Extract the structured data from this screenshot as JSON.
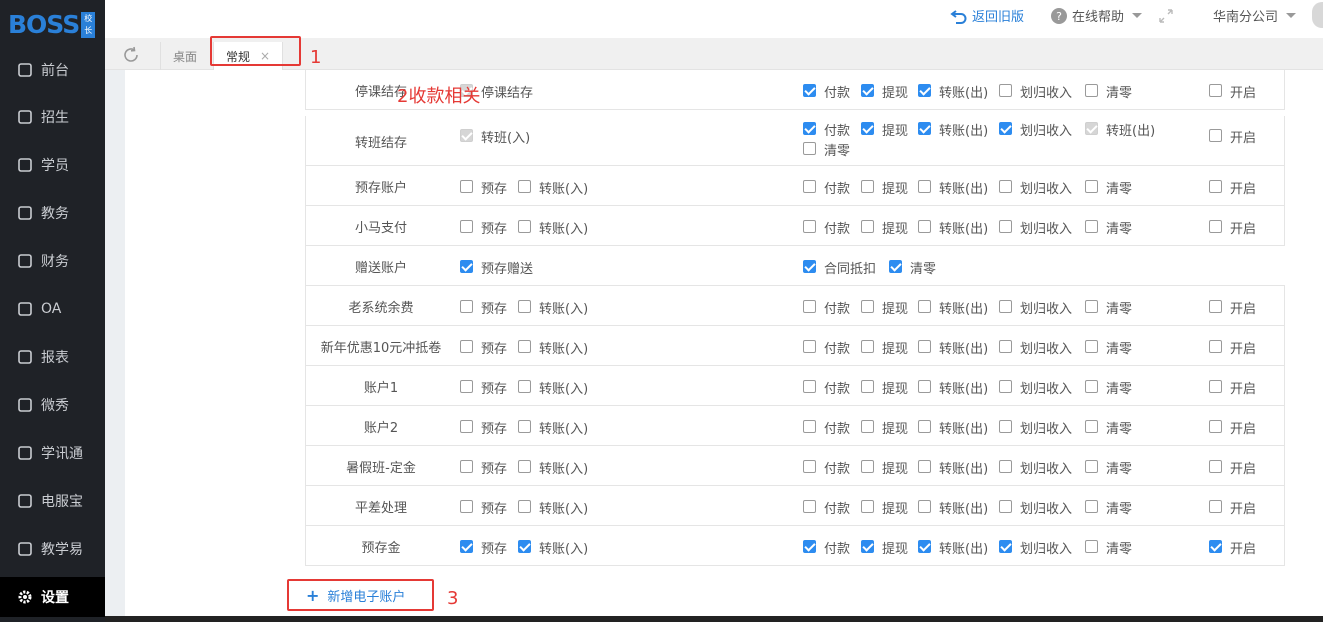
{
  "app": {
    "logo": "BOSS",
    "logo_badge": "校长"
  },
  "sidebar": {
    "items": [
      {
        "label": "前台",
        "icon": "front-desk-icon"
      },
      {
        "label": "招生",
        "icon": "enroll-icon"
      },
      {
        "label": "学员",
        "icon": "student-icon"
      },
      {
        "label": "教务",
        "icon": "academic-icon"
      },
      {
        "label": "财务",
        "icon": "finance-icon"
      },
      {
        "label": "OA",
        "icon": "oa-icon"
      },
      {
        "label": "报表",
        "icon": "report-icon"
      },
      {
        "label": "微秀",
        "icon": "weixiu-icon"
      },
      {
        "label": "学讯通",
        "icon": "location-icon"
      },
      {
        "label": "电服宝",
        "icon": "phone-service-icon"
      },
      {
        "label": "教学易",
        "icon": "teaching-icon"
      },
      {
        "label": "设置",
        "icon": "gear-icon"
      }
    ]
  },
  "topbar": {
    "back_label": "返回旧版",
    "help_label": "在线帮助",
    "company_label": "华南分公司"
  },
  "tabs": {
    "desk_label": "桌面",
    "normal_label": "常规",
    "close_glyph": "×"
  },
  "annotations": {
    "m1": "1",
    "m2": "2收款相关",
    "m3": "3"
  },
  "add_button": {
    "label": "新增电子账户",
    "plus": "+"
  },
  "table": {
    "rows": [
      {
        "name": "停课结存",
        "left": [
          {
            "checked": true,
            "disabled": true,
            "label": "停课结存"
          }
        ],
        "right": [
          {
            "checked": true,
            "label": "付款"
          },
          {
            "checked": true,
            "label": "提现"
          },
          {
            "checked": true,
            "label": "转账(出)"
          },
          {
            "checked": false,
            "label": "划归收入"
          },
          {
            "checked": false,
            "label": "清零"
          }
        ],
        "open": {
          "checked": false,
          "label": "开启"
        }
      },
      {
        "name": "转班结存",
        "left": [
          {
            "checked": true,
            "disabled": true,
            "label": "转班(入)"
          }
        ],
        "right": [
          {
            "checked": true,
            "label": "付款"
          },
          {
            "checked": true,
            "label": "提现"
          },
          {
            "checked": true,
            "label": "转账(出)"
          },
          {
            "checked": true,
            "label": "划归收入"
          },
          {
            "checked": true,
            "disabled": true,
            "label": "转班(出)"
          },
          {
            "checked": false,
            "label": "清零"
          }
        ],
        "open": {
          "checked": false,
          "label": "开启"
        }
      },
      {
        "name": "预存账户",
        "left": [
          {
            "checked": false,
            "label": "预存"
          },
          {
            "checked": false,
            "label": "转账(入)"
          }
        ],
        "right": [
          {
            "checked": false,
            "label": "付款"
          },
          {
            "checked": false,
            "label": "提现"
          },
          {
            "checked": false,
            "label": "转账(出)"
          },
          {
            "checked": false,
            "label": "划归收入"
          },
          {
            "checked": false,
            "label": "清零"
          }
        ],
        "open": {
          "checked": false,
          "label": "开启"
        }
      },
      {
        "name": "小马支付",
        "left": [
          {
            "checked": false,
            "label": "预存"
          },
          {
            "checked": false,
            "label": "转账(入)"
          }
        ],
        "right": [
          {
            "checked": false,
            "label": "付款"
          },
          {
            "checked": false,
            "label": "提现"
          },
          {
            "checked": false,
            "label": "转账(出)"
          },
          {
            "checked": false,
            "label": "划归收入"
          },
          {
            "checked": false,
            "label": "清零"
          }
        ],
        "open": {
          "checked": false,
          "label": "开启"
        }
      },
      {
        "name": "赠送账户",
        "left": [
          {
            "checked": true,
            "label": "预存赠送"
          }
        ],
        "right": [
          {
            "checked": true,
            "label": "合同抵扣"
          },
          {
            "checked": true,
            "label": "清零"
          }
        ],
        "open": null
      },
      {
        "name": "老系统余费",
        "left": [
          {
            "checked": false,
            "label": "预存"
          },
          {
            "checked": false,
            "label": "转账(入)"
          }
        ],
        "right": [
          {
            "checked": false,
            "label": "付款"
          },
          {
            "checked": false,
            "label": "提现"
          },
          {
            "checked": false,
            "label": "转账(出)"
          },
          {
            "checked": false,
            "label": "划归收入"
          },
          {
            "checked": false,
            "label": "清零"
          }
        ],
        "open": {
          "checked": false,
          "label": "开启"
        }
      },
      {
        "name": "新年优惠10元冲抵卷",
        "left": [
          {
            "checked": false,
            "label": "预存"
          },
          {
            "checked": false,
            "label": "转账(入)"
          }
        ],
        "right": [
          {
            "checked": false,
            "label": "付款"
          },
          {
            "checked": false,
            "label": "提现"
          },
          {
            "checked": false,
            "label": "转账(出)"
          },
          {
            "checked": false,
            "label": "划归收入"
          },
          {
            "checked": false,
            "label": "清零"
          }
        ],
        "open": {
          "checked": false,
          "label": "开启"
        }
      },
      {
        "name": "账户1",
        "left": [
          {
            "checked": false,
            "label": "预存"
          },
          {
            "checked": false,
            "label": "转账(入)"
          }
        ],
        "right": [
          {
            "checked": false,
            "label": "付款"
          },
          {
            "checked": false,
            "label": "提现"
          },
          {
            "checked": false,
            "label": "转账(出)"
          },
          {
            "checked": false,
            "label": "划归收入"
          },
          {
            "checked": false,
            "label": "清零"
          }
        ],
        "open": {
          "checked": false,
          "label": "开启"
        }
      },
      {
        "name": "账户2",
        "left": [
          {
            "checked": false,
            "label": "预存"
          },
          {
            "checked": false,
            "label": "转账(入)"
          }
        ],
        "right": [
          {
            "checked": false,
            "label": "付款"
          },
          {
            "checked": false,
            "label": "提现"
          },
          {
            "checked": false,
            "label": "转账(出)"
          },
          {
            "checked": false,
            "label": "划归收入"
          },
          {
            "checked": false,
            "label": "清零"
          }
        ],
        "open": {
          "checked": false,
          "label": "开启"
        }
      },
      {
        "name": "暑假班-定金",
        "left": [
          {
            "checked": false,
            "label": "预存"
          },
          {
            "checked": false,
            "label": "转账(入)"
          }
        ],
        "right": [
          {
            "checked": false,
            "label": "付款"
          },
          {
            "checked": false,
            "label": "提现"
          },
          {
            "checked": false,
            "label": "转账(出)"
          },
          {
            "checked": false,
            "label": "划归收入"
          },
          {
            "checked": false,
            "label": "清零"
          }
        ],
        "open": {
          "checked": false,
          "label": "开启"
        }
      },
      {
        "name": "平差处理",
        "left": [
          {
            "checked": false,
            "label": "预存"
          },
          {
            "checked": false,
            "label": "转账(入)"
          }
        ],
        "right": [
          {
            "checked": false,
            "label": "付款"
          },
          {
            "checked": false,
            "label": "提现"
          },
          {
            "checked": false,
            "label": "转账(出)"
          },
          {
            "checked": false,
            "label": "划归收入"
          },
          {
            "checked": false,
            "label": "清零"
          }
        ],
        "open": {
          "checked": false,
          "label": "开启"
        }
      },
      {
        "name": "预存金",
        "left": [
          {
            "checked": true,
            "label": "预存"
          },
          {
            "checked": true,
            "label": "转账(入)"
          }
        ],
        "right": [
          {
            "checked": true,
            "label": "付款"
          },
          {
            "checked": true,
            "label": "提现"
          },
          {
            "checked": true,
            "label": "转账(出)"
          },
          {
            "checked": true,
            "label": "划归收入"
          },
          {
            "checked": false,
            "label": "清零"
          }
        ],
        "open": {
          "checked": true,
          "label": "开启"
        }
      }
    ]
  }
}
